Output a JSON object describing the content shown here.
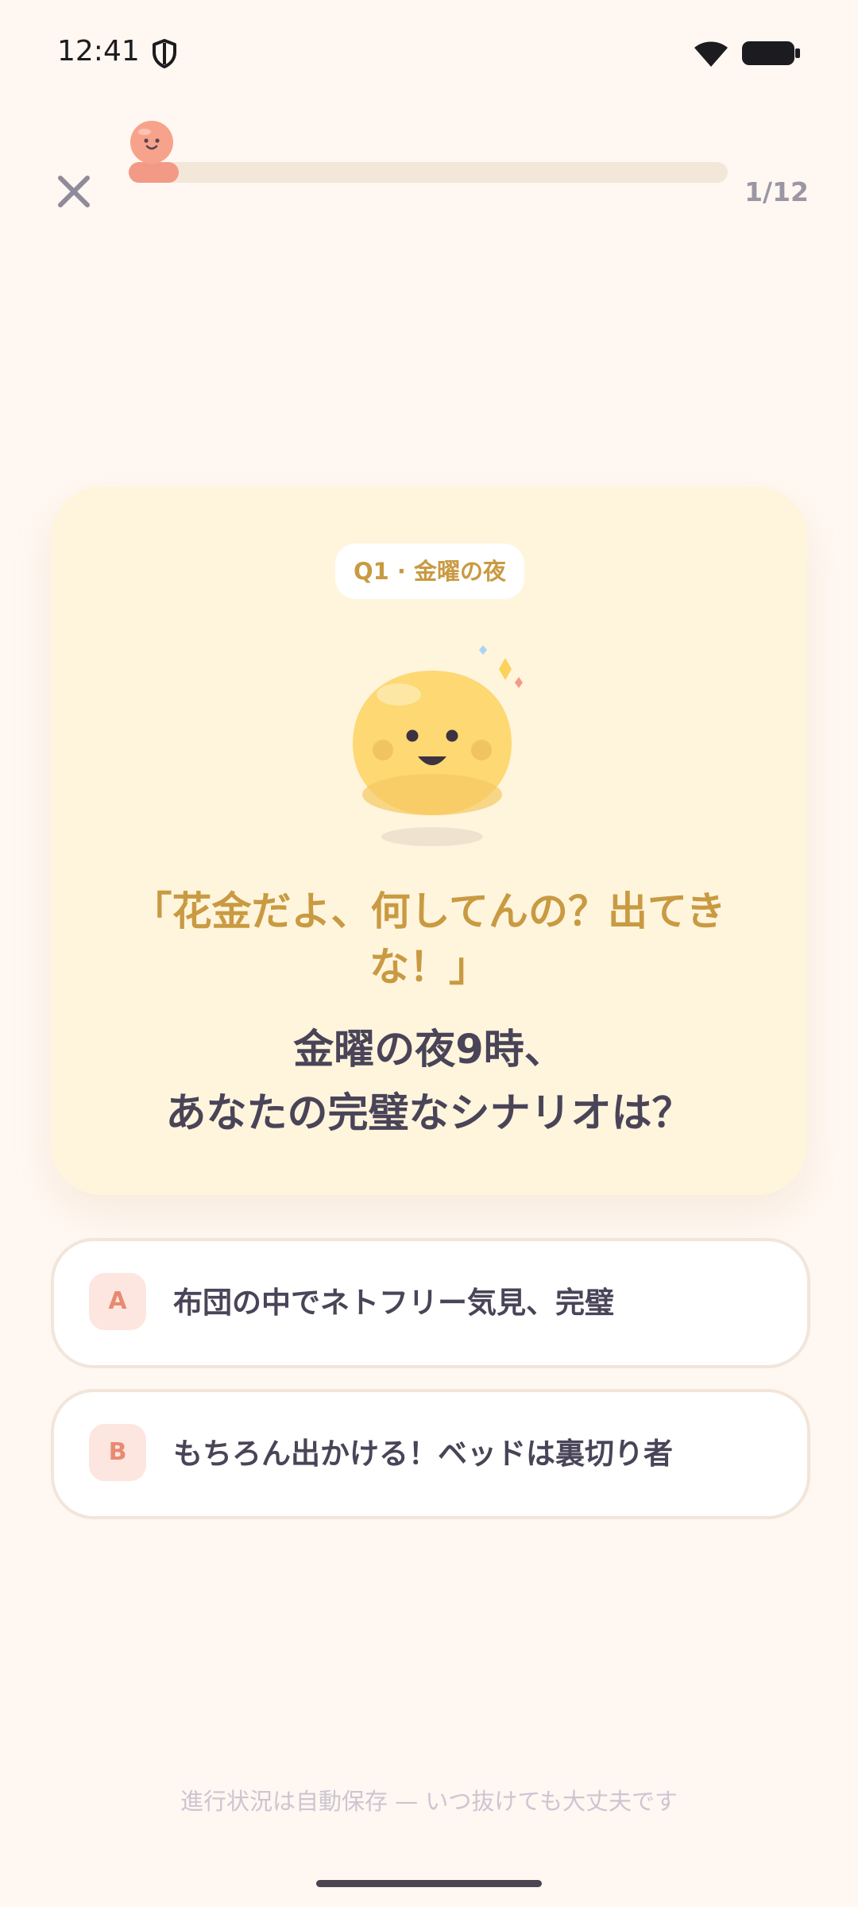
{
  "status_bar": {
    "time": "12:41",
    "icons": [
      "shield-icon",
      "wifi-icon",
      "battery-icon"
    ]
  },
  "header": {
    "close_icon": "close-icon",
    "progress": {
      "current": 1,
      "total": 12,
      "label": "1/12"
    }
  },
  "card": {
    "chip": "Q1 · 金曜の夜",
    "quote_line1": "「花金だよ、何してんの？出てき",
    "quote_line2": "な！」",
    "question_line1": "金曜の夜9時、",
    "question_line2": "あなたの完璧なシナリオは？",
    "mascot": "smiling-blob-mascot"
  },
  "answers": [
    {
      "letter": "A",
      "text": "布団の中でネトフリー気見、完璧"
    },
    {
      "letter": "B",
      "text": "もちろん出かける！ベッドは裏切り者"
    }
  ],
  "footer": {
    "note": "進行状況は自動保存 — いつ抜けても大丈夫です"
  },
  "colors": {
    "background": "#fff7f1",
    "card": "#fff5dd",
    "accent_gold": "#c99a42",
    "accent_coral": "#f29a85",
    "text": "#4a4458",
    "muted": "#9a97a3"
  }
}
